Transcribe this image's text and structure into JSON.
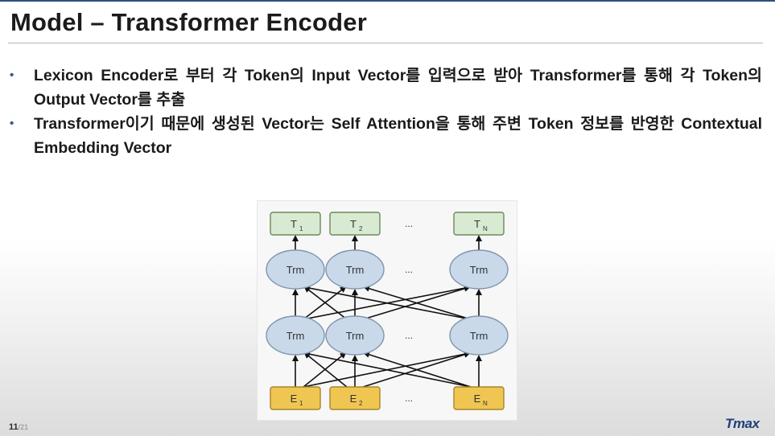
{
  "slide": {
    "title": "Model – Transformer Encoder",
    "bullets": [
      {
        "text": "Lexicon Encoder로 부터 각 Token의 Input Vector를 입력으로 받아 Transformer를 통해 각 Token의 Output Vector를 추출"
      },
      {
        "text": "Transformer이기 때문에 생성된 Vector는 Self Attention을 통해 주변 Token 정보를 반영한 Contextual Embedding Vector"
      }
    ],
    "bullet_marker": "•",
    "page_number": "11",
    "page_total": "/21",
    "logo_text": "Tmax"
  },
  "diagram": {
    "output_nodes": [
      {
        "label": "T",
        "sub": "1"
      },
      {
        "label": "T",
        "sub": "2"
      },
      {
        "label": "T",
        "sub": "N"
      }
    ],
    "upper_layer": [
      "Trm",
      "Trm",
      "Trm"
    ],
    "lower_layer": [
      "Trm",
      "Trm",
      "Trm"
    ],
    "input_nodes": [
      {
        "label": "E",
        "sub": "1"
      },
      {
        "label": "E",
        "sub": "2"
      },
      {
        "label": "E",
        "sub": "N"
      }
    ],
    "ellipsis": "...",
    "colors": {
      "output_fill": "#d9ead3",
      "output_stroke": "#6a8a5a",
      "trm_fill": "#c9d9ea",
      "trm_stroke": "#7f95ad",
      "input_fill": "#f0c653",
      "input_stroke": "#a8842a",
      "arrow": "#111111"
    }
  }
}
